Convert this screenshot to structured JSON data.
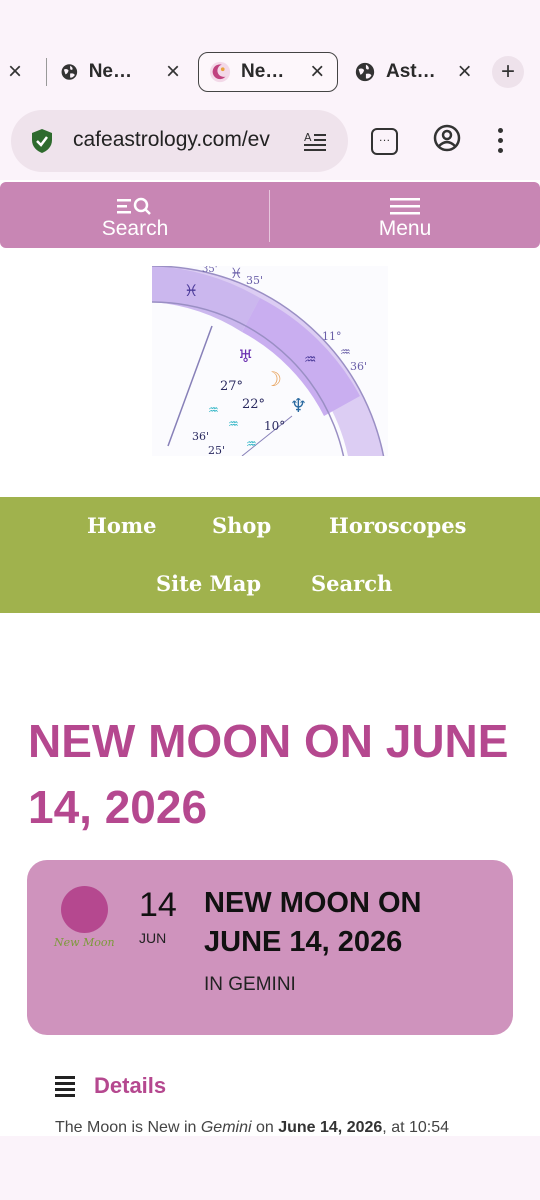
{
  "browser": {
    "tabs": [
      {
        "title": "",
        "close": "×"
      },
      {
        "title": "Ne…",
        "close": "×"
      },
      {
        "title": "Ne…",
        "close": "×",
        "active": true
      },
      {
        "title": "Ast…",
        "close": "×"
      }
    ],
    "new_tab": "+",
    "url": "cafeastrology.com/ev",
    "tab_count_glyph": "…"
  },
  "site_header": {
    "search_label": "Search",
    "menu_label": "Menu"
  },
  "chart_image": {
    "labels": [
      "♓",
      "♓",
      "35'",
      "11°",
      "♒",
      "♒",
      "36'",
      "♅",
      "☽",
      "27°",
      "22°",
      "♆",
      "♒",
      "♒",
      "10°",
      "36'",
      "25'",
      "♒"
    ]
  },
  "nav": {
    "items": [
      "Home",
      "Shop",
      "Horoscopes",
      "Site Map",
      "Search"
    ]
  },
  "page": {
    "title_line1": "NEW MOON ON JUNE",
    "title_line2": "14, 2026"
  },
  "event": {
    "image_caption": "New Moon",
    "day": "14",
    "month": "JUN",
    "title_line1": "NEW MOON ON",
    "title_line2": "JUNE 14, 2026",
    "subtitle": "IN GEMINI"
  },
  "details": {
    "label": "Details",
    "text_prefix": "The Moon is New in ",
    "sign": "Gemini",
    "text_mid": " on ",
    "date": "June 14, 2026",
    "text_suffix": ", at 10:54"
  },
  "colors": {
    "accent": "#b5488f",
    "header_pink": "#c886b4",
    "card_pink": "#cf93bd",
    "nav_green": "#a0b24d"
  }
}
